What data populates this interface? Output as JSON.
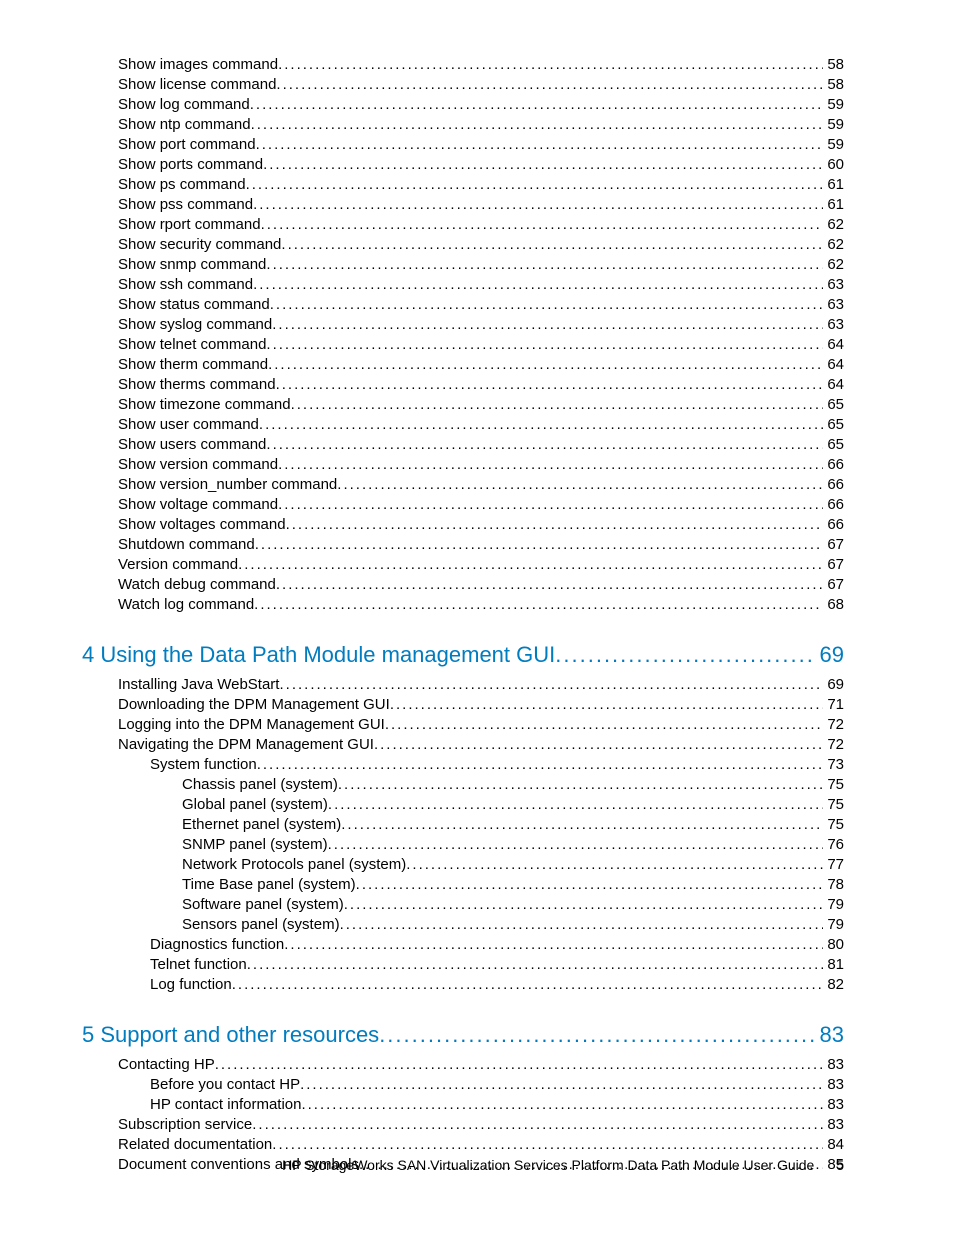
{
  "footer": {
    "title": "HP StorageWorks SAN Virtualization Services Platform Data Path Module User Guide",
    "page": "5"
  },
  "sections": [
    {
      "heading": null,
      "entries": [
        {
          "t": "Show images command",
          "p": "58",
          "i": 0
        },
        {
          "t": "Show license command",
          "p": "58",
          "i": 0
        },
        {
          "t": "Show log command",
          "p": "59",
          "i": 0
        },
        {
          "t": "Show ntp command",
          "p": "59",
          "i": 0
        },
        {
          "t": "Show port command",
          "p": "59",
          "i": 0
        },
        {
          "t": "Show ports command",
          "p": "60",
          "i": 0
        },
        {
          "t": "Show ps command",
          "p": "61",
          "i": 0
        },
        {
          "t": "Show pss command",
          "p": "61",
          "i": 0
        },
        {
          "t": "Show rport command",
          "p": "62",
          "i": 0
        },
        {
          "t": "Show security command",
          "p": "62",
          "i": 0
        },
        {
          "t": "Show snmp command",
          "p": "62",
          "i": 0
        },
        {
          "t": "Show ssh command",
          "p": "63",
          "i": 0
        },
        {
          "t": "Show status command",
          "p": "63",
          "i": 0
        },
        {
          "t": "Show syslog command",
          "p": "63",
          "i": 0
        },
        {
          "t": "Show telnet command",
          "p": "64",
          "i": 0
        },
        {
          "t": "Show therm command",
          "p": "64",
          "i": 0
        },
        {
          "t": "Show therms command",
          "p": "64",
          "i": 0
        },
        {
          "t": "Show timezone command",
          "p": "65",
          "i": 0
        },
        {
          "t": "Show user command",
          "p": "65",
          "i": 0
        },
        {
          "t": "Show users command",
          "p": "65",
          "i": 0
        },
        {
          "t": "Show version command",
          "p": "66",
          "i": 0
        },
        {
          "t": "Show version_number command",
          "p": "66",
          "i": 0
        },
        {
          "t": "Show voltage command",
          "p": "66",
          "i": 0
        },
        {
          "t": "Show voltages command",
          "p": "66",
          "i": 0
        },
        {
          "t": "Shutdown command",
          "p": "67",
          "i": 0
        },
        {
          "t": "Version command",
          "p": "67",
          "i": 0
        },
        {
          "t": "Watch debug command",
          "p": "67",
          "i": 0
        },
        {
          "t": "Watch log command",
          "p": "68",
          "i": 0
        }
      ]
    },
    {
      "heading": {
        "t": "4 Using the Data Path Module management GUI",
        "p": "69"
      },
      "entries": [
        {
          "t": "Installing Java WebStart",
          "p": "69",
          "i": 0
        },
        {
          "t": "Downloading the DPM Management GUI",
          "p": "71",
          "i": 0
        },
        {
          "t": "Logging into the DPM Management GUI",
          "p": "72",
          "i": 0
        },
        {
          "t": "Navigating the DPM Management GUI",
          "p": "72",
          "i": 0
        },
        {
          "t": "System function",
          "p": "73",
          "i": 1
        },
        {
          "t": "Chassis panel (system)",
          "p": "75",
          "i": 2
        },
        {
          "t": "Global panel (system)",
          "p": "75",
          "i": 2
        },
        {
          "t": "Ethernet panel (system)",
          "p": "75",
          "i": 2
        },
        {
          "t": "SNMP panel (system)",
          "p": "76",
          "i": 2
        },
        {
          "t": "Network Protocols panel (system)",
          "p": "77",
          "i": 2
        },
        {
          "t": "Time Base panel (system)",
          "p": "78",
          "i": 2
        },
        {
          "t": "Software panel (system)",
          "p": "79",
          "i": 2
        },
        {
          "t": "Sensors panel (system)",
          "p": "79",
          "i": 2
        },
        {
          "t": "Diagnostics function",
          "p": "80",
          "i": 1
        },
        {
          "t": "Telnet function",
          "p": "81",
          "i": 1
        },
        {
          "t": "Log function",
          "p": "82",
          "i": 1
        }
      ]
    },
    {
      "heading": {
        "t": "5 Support and other resources",
        "p": "83"
      },
      "entries": [
        {
          "t": "Contacting HP",
          "p": "83",
          "i": 0
        },
        {
          "t": "Before you contact HP",
          "p": "83",
          "i": 1
        },
        {
          "t": "HP contact information",
          "p": "83",
          "i": 1
        },
        {
          "t": "Subscription service",
          "p": "83",
          "i": 0
        },
        {
          "t": "Related documentation",
          "p": "84",
          "i": 0
        },
        {
          "t": "Document conventions and symbols",
          "p": "85",
          "i": 0
        }
      ]
    }
  ]
}
